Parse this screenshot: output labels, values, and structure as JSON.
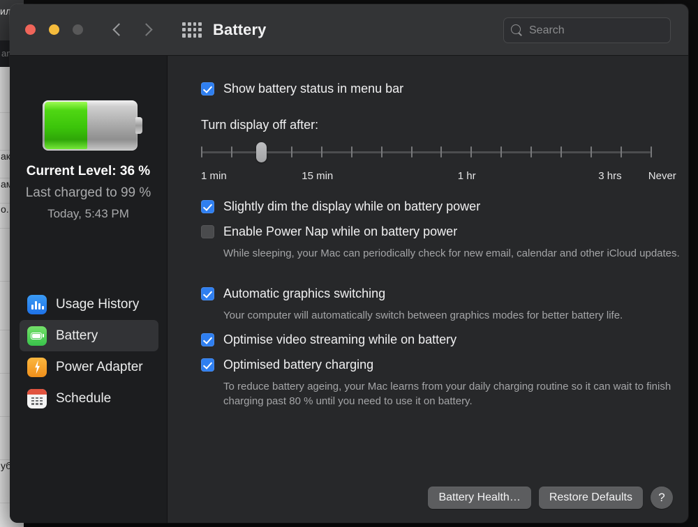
{
  "background": {
    "top_text": "ил",
    "subbar_text": "am",
    "rows": [
      "",
      "",
      "ак",
      "ам",
      "о.",
      "",
      "",
      "",
      "",
      "",
      "уб"
    ]
  },
  "toolbar": {
    "title": "Battery",
    "back_icon": "chevron-left-icon",
    "forward_icon": "chevron-right-icon",
    "grid_icon": "show-all-grid-icon",
    "close_label": "close",
    "minimize_label": "minimize",
    "zoom_label": "zoom"
  },
  "search": {
    "placeholder": "Search",
    "value": "",
    "icon": "search-icon"
  },
  "sidebar": {
    "battery_icon": "battery-status-graphic",
    "battery_fill_percent": 36,
    "current_level": "Current Level: 36 %",
    "last_charged": "Last charged to 99 %",
    "last_charged_time": "Today, 5:43 PM",
    "items": [
      {
        "label": "Usage History",
        "icon": "usage-history-icon",
        "selected": false
      },
      {
        "label": "Battery",
        "icon": "battery-icon",
        "selected": true
      },
      {
        "label": "Power Adapter",
        "icon": "power-adapter-icon",
        "selected": false
      },
      {
        "label": "Schedule",
        "icon": "schedule-calendar-icon",
        "selected": false
      }
    ]
  },
  "main": {
    "menubar_checkbox": {
      "label": "Show battery status in menu bar",
      "checked": true
    },
    "display_off_label": "Turn display off after:",
    "slider": {
      "ticks": 16,
      "thumb_tick_index": 2,
      "labels": [
        {
          "text": "1 min",
          "pos_pct": 0
        },
        {
          "text": "15 min",
          "pos_pct": 22.4
        },
        {
          "text": "1 hr",
          "pos_pct": 57.1
        },
        {
          "text": "3 hrs",
          "pos_pct": 88.4
        },
        {
          "text": "Never",
          "pos_pct": 99.5
        }
      ]
    },
    "options": [
      {
        "label": "Slightly dim the display while on battery power",
        "checked": true,
        "desc": ""
      },
      {
        "label": "Enable Power Nap while on battery power",
        "checked": false,
        "desc": "While sleeping, your Mac can periodically check for new email, calendar and other iCloud updates."
      },
      {
        "label": "Automatic graphics switching",
        "checked": true,
        "desc": "Your computer will automatically switch between graphics modes for better battery life."
      },
      {
        "label": "Optimise video streaming while on battery",
        "checked": true,
        "desc": ""
      },
      {
        "label": "Optimised battery charging",
        "checked": true,
        "desc": "To reduce battery ageing, your Mac learns from your daily charging routine so it can wait to finish charging past 80 % until you need to use it on battery."
      }
    ]
  },
  "footer": {
    "battery_health_label": "Battery Health…",
    "restore_defaults_label": "Restore Defaults",
    "help_label": "?"
  },
  "colors": {
    "accent": "#2f7ff0",
    "battery_green": "#4fd713",
    "window_bg": "#27282a",
    "sidebar_bg": "#1c1d1f",
    "toolbar_bg": "#333436"
  }
}
